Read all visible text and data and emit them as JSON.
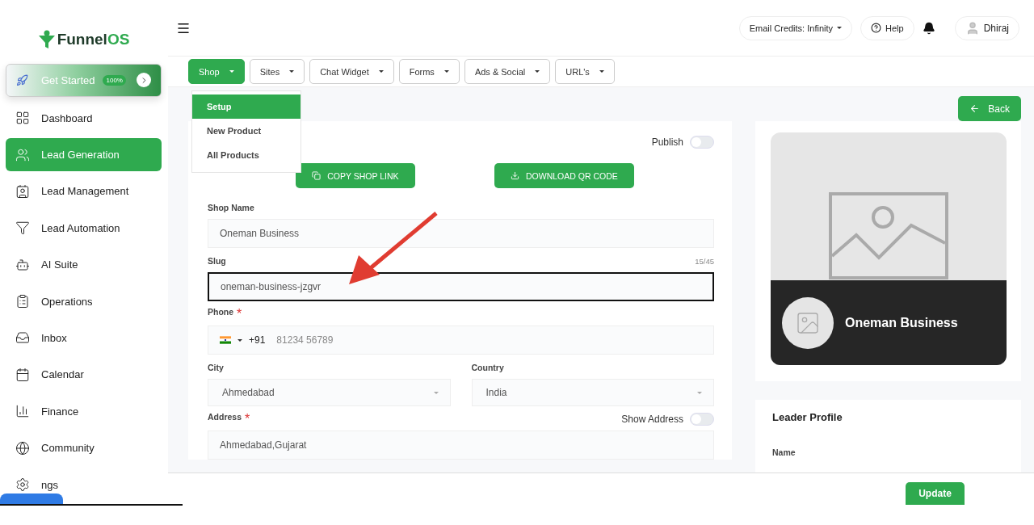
{
  "sidebar": {
    "logo": {
      "prefix": "Funnel",
      "suffix": "OS"
    },
    "get_started": {
      "label": "Get Started",
      "badge": "100%"
    },
    "items": [
      {
        "label": "Dashboard",
        "selected": false
      },
      {
        "label": "Lead Generation",
        "selected": true
      },
      {
        "label": "Lead Management",
        "selected": false
      },
      {
        "label": "Lead Automation",
        "selected": false
      },
      {
        "label": "AI Suite",
        "selected": false
      },
      {
        "label": "Operations",
        "selected": false
      },
      {
        "label": "Inbox",
        "selected": false
      },
      {
        "label": "Calendar",
        "selected": false
      },
      {
        "label": "Finance",
        "selected": false
      },
      {
        "label": "Community",
        "selected": false
      },
      {
        "label": "ngs",
        "selected": false
      }
    ]
  },
  "header": {
    "credits": "Email Credits: Infinity",
    "help": "Help",
    "user": "Dhiraj"
  },
  "tabs": [
    {
      "label": "Shop",
      "selected": true,
      "menu": [
        {
          "label": "Setup",
          "selected": true
        },
        {
          "label": "New Product",
          "selected": false
        },
        {
          "label": "All Products",
          "selected": false
        }
      ]
    },
    {
      "label": "Sites",
      "selected": false
    },
    {
      "label": "Chat Widget",
      "selected": false
    },
    {
      "label": "Forms",
      "selected": false
    },
    {
      "label": "Ads & Social",
      "selected": false
    },
    {
      "label": "URL's",
      "selected": false
    }
  ],
  "back": "Back",
  "form": {
    "publish": {
      "label": "Publish",
      "on": false
    },
    "actions": [
      "COPY SHOP LINK",
      "DOWNLOAD QR CODE"
    ],
    "fields": [
      {
        "kind": "text",
        "label": "Shop Name",
        "value": "Oneman Business",
        "focused": false
      },
      {
        "kind": "text",
        "label": "Slug",
        "value": "oneman-business-jzgvr",
        "counter": "15/45",
        "focused": true
      },
      {
        "kind": "phone",
        "label": "Phone",
        "required_mark": "*",
        "code": "+91",
        "placeholder": "81234 56789"
      },
      {
        "kind": "selects",
        "items": [
          {
            "label": "City",
            "value": "Ahmedabad"
          },
          {
            "label": "Country",
            "value": "India"
          }
        ]
      },
      {
        "kind": "text",
        "label": "Address",
        "required_mark": "*",
        "value": "Ahmedabad,Gujarat",
        "focused": false,
        "toggle": {
          "label": "Show Address",
          "on": false
        }
      }
    ]
  },
  "preview": {
    "name": "Oneman Business"
  },
  "leader_profile": {
    "title": "Leader Profile",
    "field_label": "Name"
  },
  "footer": {
    "button": "Update"
  }
}
